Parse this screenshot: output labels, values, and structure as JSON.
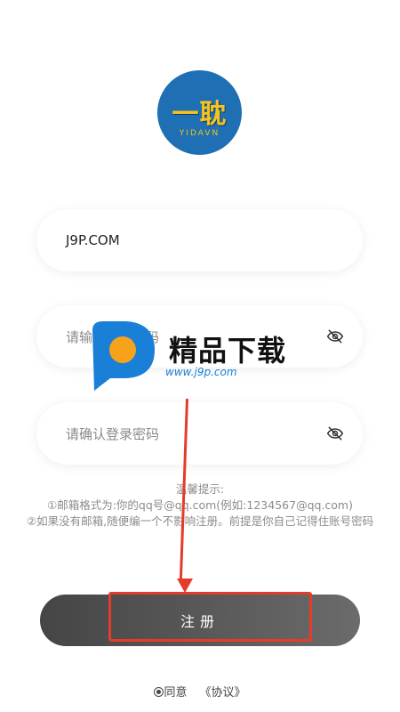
{
  "logo": {
    "text": "一耽",
    "subtext": "YIDAVN"
  },
  "form": {
    "email_value": "J9P.COM",
    "password_placeholder": "请输入登录密码",
    "confirm_placeholder": "请确认登录密码"
  },
  "tips": {
    "title": "温馨提示:",
    "line1": "①邮箱格式为:你的qq号@qq.com(例如:1234567@qq.com)",
    "line2": "②如果没有邮箱,随便编一个不影响注册。前提是你自己记得住账号密码"
  },
  "register_label": "注册",
  "agree": {
    "label": "同意",
    "link": "《协议》"
  },
  "watermark": {
    "title": "精品下载",
    "url": "www.j9p.com"
  },
  "colors": {
    "accent_red": "#e53b2a",
    "button": "#555555",
    "logo_bg": "#1e6fb3"
  }
}
